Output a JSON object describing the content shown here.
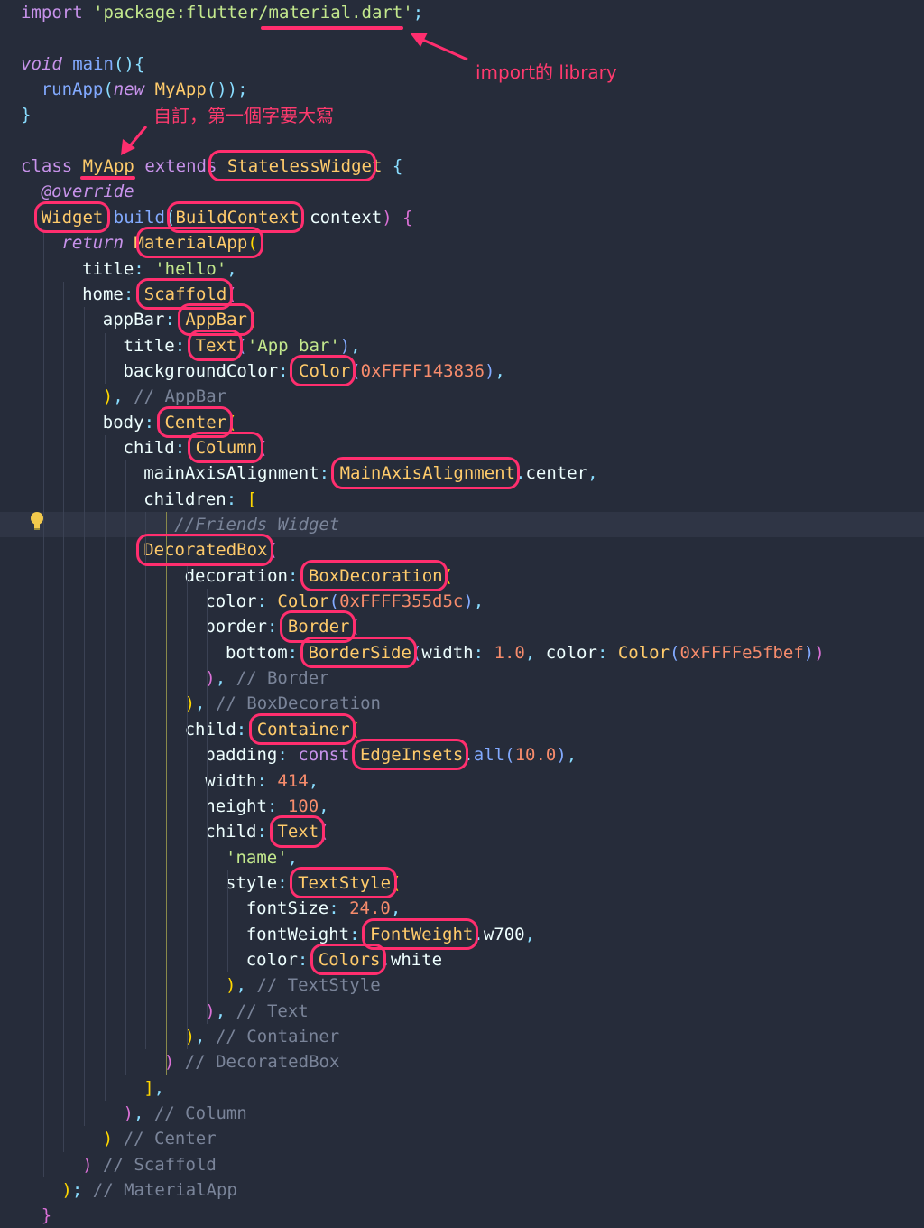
{
  "annotations": {
    "import_note": "import的 library",
    "class_note": "自訂，第一個字要大寫"
  },
  "code": [
    [
      [
        "k",
        "import"
      ],
      [
        "wt",
        " "
      ],
      [
        "s",
        "'package:flutter/material.dart'"
      ],
      [
        "p",
        ";"
      ]
    ],
    [],
    [
      [
        "k-i",
        "void"
      ],
      [
        "wt",
        " "
      ],
      [
        "f",
        "main"
      ],
      [
        "p",
        "(){"
      ]
    ],
    [
      [
        "f",
        "runApp"
      ],
      [
        "p",
        "("
      ],
      [
        "k-i",
        "new"
      ],
      [
        "wt",
        " "
      ],
      [
        "c",
        "MyApp"
      ],
      [
        "p",
        "());"
      ]
    ],
    [
      [
        "p",
        "}"
      ]
    ],
    [],
    [
      [
        "k",
        "class"
      ],
      [
        "wt",
        " "
      ],
      [
        "c",
        "MyApp"
      ],
      [
        "wt",
        " "
      ],
      [
        "k",
        "extends"
      ],
      [
        "wt",
        " "
      ],
      [
        "c",
        "StatelessWidget"
      ],
      [
        "wt",
        " "
      ],
      [
        "p",
        "{"
      ]
    ],
    [
      [
        "k-i",
        "@override"
      ]
    ],
    [
      [
        "c",
        "Widget"
      ],
      [
        "wt",
        " "
      ],
      [
        "f",
        "build"
      ],
      [
        "p",
        "("
      ],
      [
        "c",
        "BuildContext"
      ],
      [
        "wt",
        " "
      ],
      [
        "pr",
        "context"
      ],
      [
        "br2",
        ")"
      ],
      [
        "wt",
        " "
      ],
      [
        "br2",
        "{"
      ]
    ],
    [
      [
        "k-i",
        "return"
      ],
      [
        "wt",
        " "
      ],
      [
        "c",
        "MaterialApp"
      ],
      [
        "br",
        "("
      ]
    ],
    [
      [
        "pr",
        "title"
      ],
      [
        "p",
        ":"
      ],
      [
        "wt",
        " "
      ],
      [
        "s",
        "'hello'"
      ],
      [
        "p",
        ","
      ]
    ],
    [
      [
        "pr",
        "home"
      ],
      [
        "p",
        ":"
      ],
      [
        "wt",
        " "
      ],
      [
        "c",
        "Scaffold"
      ],
      [
        "br2",
        "("
      ]
    ],
    [
      [
        "pr",
        "appBar"
      ],
      [
        "p",
        ":"
      ],
      [
        "wt",
        " "
      ],
      [
        "c",
        "AppBar"
      ],
      [
        "br",
        "("
      ]
    ],
    [
      [
        "pr",
        "title"
      ],
      [
        "p",
        ":"
      ],
      [
        "wt",
        " "
      ],
      [
        "c",
        "Text"
      ],
      [
        "f",
        "("
      ],
      [
        "s",
        "'App bar'"
      ],
      [
        "f",
        ")"
      ],
      [
        "p",
        ","
      ]
    ],
    [
      [
        "pr",
        "backgroundColor"
      ],
      [
        "p",
        ":"
      ],
      [
        "wt",
        " "
      ],
      [
        "c",
        "Color"
      ],
      [
        "f",
        "("
      ],
      [
        "n",
        "0xFFFF143836"
      ],
      [
        "f",
        ")"
      ],
      [
        "p",
        ","
      ]
    ],
    [
      [
        "br",
        ")"
      ],
      [
        "p",
        ","
      ],
      [
        "wt",
        " "
      ],
      [
        "cm",
        "// AppBar"
      ]
    ],
    [
      [
        "pr",
        "body"
      ],
      [
        "p",
        ":"
      ],
      [
        "wt",
        " "
      ],
      [
        "c",
        "Center"
      ],
      [
        "br",
        "("
      ]
    ],
    [
      [
        "pr",
        "child"
      ],
      [
        "p",
        ":"
      ],
      [
        "wt",
        " "
      ],
      [
        "c",
        "Column"
      ],
      [
        "br2",
        "("
      ]
    ],
    [
      [
        "pr",
        "mainAxisAlignment"
      ],
      [
        "p",
        ":"
      ],
      [
        "wt",
        " "
      ],
      [
        "c",
        "MainAxisAlignment"
      ],
      [
        "p",
        "."
      ],
      [
        "pr",
        "center"
      ],
      [
        "p",
        ","
      ]
    ],
    [
      [
        "pr",
        "children"
      ],
      [
        "p",
        ":"
      ],
      [
        "wt",
        " "
      ],
      [
        "br",
        "["
      ]
    ],
    [
      [
        "cm-i",
        "//Friends Widget"
      ]
    ],
    [
      [
        "c",
        "DecoratedBox"
      ],
      [
        "br2",
        "("
      ]
    ],
    [
      [
        "pr",
        "decoration"
      ],
      [
        "p",
        ":"
      ],
      [
        "wt",
        " "
      ],
      [
        "c",
        "BoxDecoration"
      ],
      [
        "br",
        "("
      ]
    ],
    [
      [
        "pr",
        "color"
      ],
      [
        "p",
        ":"
      ],
      [
        "wt",
        " "
      ],
      [
        "c",
        "Color"
      ],
      [
        "f",
        "("
      ],
      [
        "n",
        "0xFFFF355d5c"
      ],
      [
        "f",
        ")"
      ],
      [
        "p",
        ","
      ]
    ],
    [
      [
        "pr",
        "border"
      ],
      [
        "p",
        ":"
      ],
      [
        "wt",
        " "
      ],
      [
        "c",
        "Border"
      ],
      [
        "br2",
        "("
      ]
    ],
    [
      [
        "pr",
        "bottom"
      ],
      [
        "p",
        ":"
      ],
      [
        "wt",
        " "
      ],
      [
        "c",
        "BorderSide"
      ],
      [
        "f",
        "("
      ],
      [
        "pr",
        "width"
      ],
      [
        "p",
        ":"
      ],
      [
        "wt",
        " "
      ],
      [
        "n",
        "1.0"
      ],
      [
        "p",
        ","
      ],
      [
        "wt",
        " "
      ],
      [
        "pr",
        "color"
      ],
      [
        "p",
        ":"
      ],
      [
        "wt",
        " "
      ],
      [
        "c",
        "Color"
      ],
      [
        "f",
        "("
      ],
      [
        "n",
        "0xFFFFe5fbef"
      ],
      [
        "f",
        ")"
      ],
      [
        "br2",
        ")"
      ]
    ],
    [
      [
        "br2",
        ")"
      ],
      [
        "p",
        ","
      ],
      [
        "wt",
        " "
      ],
      [
        "cm",
        "// Border"
      ]
    ],
    [
      [
        "br",
        ")"
      ],
      [
        "p",
        ","
      ],
      [
        "wt",
        " "
      ],
      [
        "cm",
        "// BoxDecoration"
      ]
    ],
    [
      [
        "pr",
        "child"
      ],
      [
        "p",
        ":"
      ],
      [
        "wt",
        " "
      ],
      [
        "c",
        "Container"
      ],
      [
        "br",
        "("
      ]
    ],
    [
      [
        "pr",
        "padding"
      ],
      [
        "p",
        ":"
      ],
      [
        "wt",
        " "
      ],
      [
        "k",
        "const"
      ],
      [
        "wt",
        " "
      ],
      [
        "c",
        "EdgeInsets"
      ],
      [
        "p",
        "."
      ],
      [
        "f",
        "all"
      ],
      [
        "f",
        "("
      ],
      [
        "n",
        "10.0"
      ],
      [
        "f",
        ")"
      ],
      [
        "p",
        ","
      ]
    ],
    [
      [
        "pr",
        "width"
      ],
      [
        "p",
        ":"
      ],
      [
        "wt",
        " "
      ],
      [
        "n",
        "414"
      ],
      [
        "p",
        ","
      ]
    ],
    [
      [
        "pr",
        "height"
      ],
      [
        "p",
        ":"
      ],
      [
        "wt",
        " "
      ],
      [
        "n",
        "100"
      ],
      [
        "p",
        ","
      ]
    ],
    [
      [
        "pr",
        "child"
      ],
      [
        "p",
        ":"
      ],
      [
        "wt",
        " "
      ],
      [
        "c",
        "Text"
      ],
      [
        "br2",
        "("
      ]
    ],
    [
      [
        "s",
        "'name'"
      ],
      [
        "p",
        ","
      ]
    ],
    [
      [
        "pr",
        "style"
      ],
      [
        "p",
        ":"
      ],
      [
        "wt",
        " "
      ],
      [
        "c",
        "TextStyle"
      ],
      [
        "br",
        "("
      ]
    ],
    [
      [
        "pr",
        "fontSize"
      ],
      [
        "p",
        ":"
      ],
      [
        "wt",
        " "
      ],
      [
        "n",
        "24.0"
      ],
      [
        "p",
        ","
      ]
    ],
    [
      [
        "pr",
        "fontWeight"
      ],
      [
        "p",
        ":"
      ],
      [
        "wt",
        " "
      ],
      [
        "c",
        "FontWeight"
      ],
      [
        "p",
        "."
      ],
      [
        "pr",
        "w700"
      ],
      [
        "p",
        ","
      ]
    ],
    [
      [
        "pr",
        "color"
      ],
      [
        "p",
        ":"
      ],
      [
        "wt",
        " "
      ],
      [
        "c",
        "Colors"
      ],
      [
        "p",
        "."
      ],
      [
        "pr",
        "white"
      ]
    ],
    [
      [
        "br",
        ")"
      ],
      [
        "p",
        ","
      ],
      [
        "wt",
        " "
      ],
      [
        "cm",
        "// TextStyle"
      ]
    ],
    [
      [
        "br2",
        ")"
      ],
      [
        "p",
        ","
      ],
      [
        "wt",
        " "
      ],
      [
        "cm",
        "// Text"
      ]
    ],
    [
      [
        "br",
        ")"
      ],
      [
        "p",
        ","
      ],
      [
        "wt",
        " "
      ],
      [
        "cm",
        "// Container"
      ]
    ],
    [
      [
        "br2",
        ")"
      ],
      [
        "wt",
        " "
      ],
      [
        "cm",
        "// DecoratedBox"
      ]
    ],
    [
      [
        "br",
        "]"
      ],
      [
        "p",
        ","
      ]
    ],
    [
      [
        "br2",
        ")"
      ],
      [
        "p",
        ","
      ],
      [
        "wt",
        " "
      ],
      [
        "cm",
        "// Column"
      ]
    ],
    [
      [
        "br",
        ")"
      ],
      [
        "wt",
        " "
      ],
      [
        "cm",
        "// Center"
      ]
    ],
    [
      [
        "br2",
        ")"
      ],
      [
        "wt",
        " "
      ],
      [
        "cm",
        "// Scaffold"
      ]
    ],
    [
      [
        "br",
        ")"
      ],
      [
        "p",
        ";"
      ],
      [
        "wt",
        " "
      ],
      [
        "cm",
        "// MaterialApp"
      ]
    ],
    [
      [
        "br2",
        "}"
      ]
    ]
  ]
}
